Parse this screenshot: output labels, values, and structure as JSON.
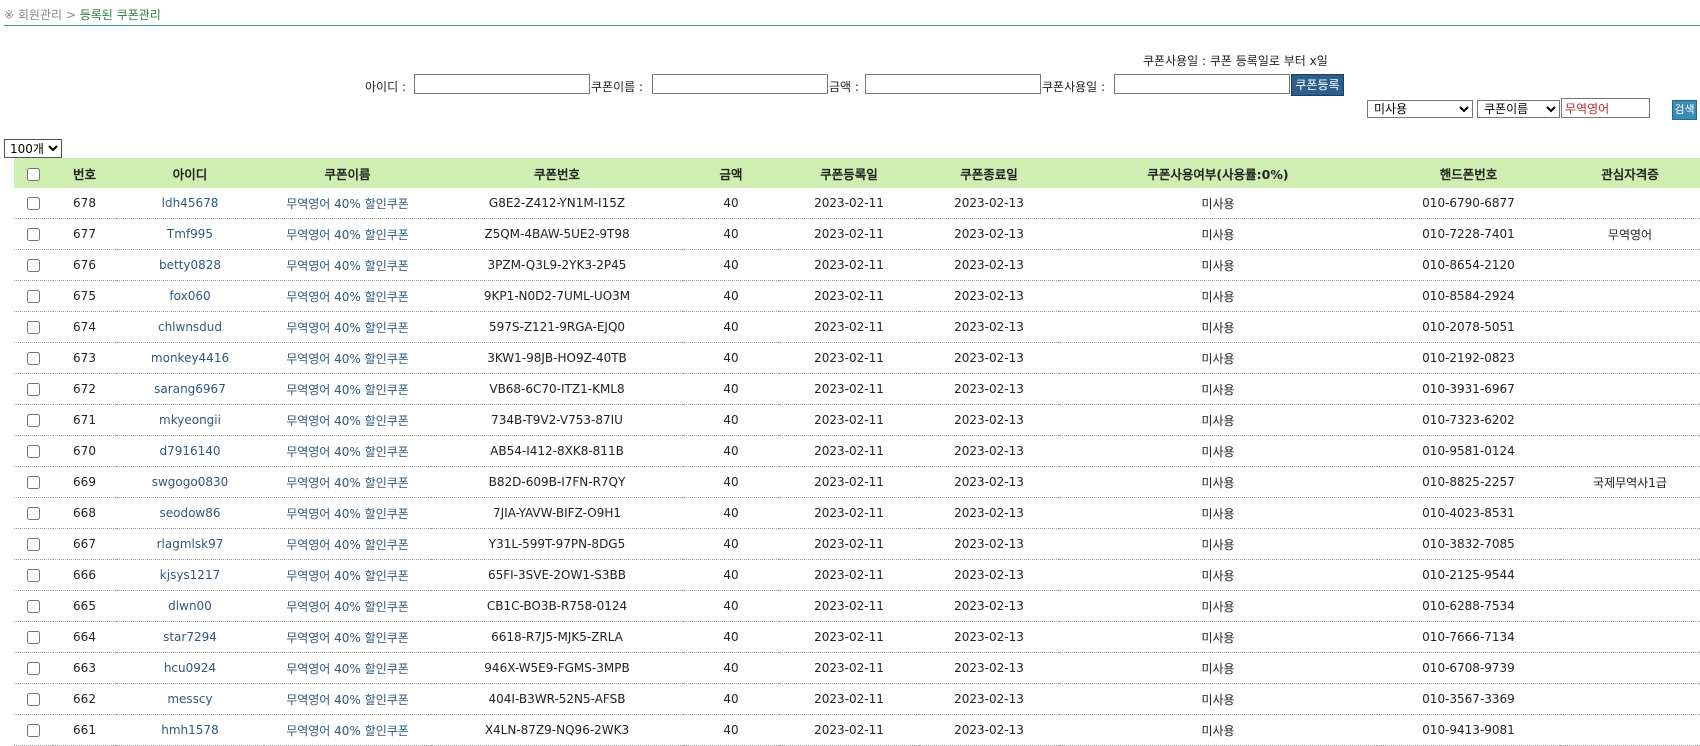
{
  "breadcrumb": {
    "prefix": "※ 회원관리 > ",
    "current": "등록된 쿠폰관리"
  },
  "note": "쿠폰사용일 : 쿠폰 등록일로 부터 x일",
  "register": {
    "id_label": "아이디 :",
    "name_label": "쿠폰이름 :",
    "amount_label": "금액 :",
    "days_label": "쿠폰사용일 :",
    "submit": "쿠폰등록"
  },
  "search": {
    "status_selected": "미사용",
    "field_selected": "쿠폰이름",
    "keyword": "무역영어",
    "button": "검색"
  },
  "perpage": "100개",
  "table": {
    "headers": [
      "번호",
      "아이디",
      "쿠폰이름",
      "쿠폰번호",
      "금액",
      "쿠폰등록일",
      "쿠폰종료일",
      "쿠폰사용여부(사용률:0%)",
      "핸드폰번호",
      "관심자격증"
    ],
    "rows": [
      {
        "no": "678",
        "id": "ldh45678",
        "name": "무역영어 40% 할인쿠폰",
        "code": "G8E2-Z412-YN1M-I15Z",
        "amount": "40",
        "reg": "2023-02-11",
        "end": "2023-02-13",
        "used": "미사용",
        "phone": "010-6790-6877",
        "interest": ""
      },
      {
        "no": "677",
        "id": "Tmf995",
        "name": "무역영어 40% 할인쿠폰",
        "code": "Z5QM-4BAW-5UE2-9T98",
        "amount": "40",
        "reg": "2023-02-11",
        "end": "2023-02-13",
        "used": "미사용",
        "phone": "010-7228-7401",
        "interest": "무역영어"
      },
      {
        "no": "676",
        "id": "betty0828",
        "name": "무역영어 40% 할인쿠폰",
        "code": "3PZM-Q3L9-2YK3-2P45",
        "amount": "40",
        "reg": "2023-02-11",
        "end": "2023-02-13",
        "used": "미사용",
        "phone": "010-8654-2120",
        "interest": ""
      },
      {
        "no": "675",
        "id": "fox060",
        "name": "무역영어 40% 할인쿠폰",
        "code": "9KP1-N0D2-7UML-UO3M",
        "amount": "40",
        "reg": "2023-02-11",
        "end": "2023-02-13",
        "used": "미사용",
        "phone": "010-8584-2924",
        "interest": ""
      },
      {
        "no": "674",
        "id": "chlwnsdud",
        "name": "무역영어 40% 할인쿠폰",
        "code": "597S-Z121-9RGA-EJQ0",
        "amount": "40",
        "reg": "2023-02-11",
        "end": "2023-02-13",
        "used": "미사용",
        "phone": "010-2078-5051",
        "interest": ""
      },
      {
        "no": "673",
        "id": "monkey4416",
        "name": "무역영어 40% 할인쿠폰",
        "code": "3KW1-98JB-HO9Z-40TB",
        "amount": "40",
        "reg": "2023-02-11",
        "end": "2023-02-13",
        "used": "미사용",
        "phone": "010-2192-0823",
        "interest": ""
      },
      {
        "no": "672",
        "id": "sarang6967",
        "name": "무역영어 40% 할인쿠폰",
        "code": "VB68-6C70-ITZ1-KML8",
        "amount": "40",
        "reg": "2023-02-11",
        "end": "2023-02-13",
        "used": "미사용",
        "phone": "010-3931-6967",
        "interest": ""
      },
      {
        "no": "671",
        "id": "mkyeongii",
        "name": "무역영어 40% 할인쿠폰",
        "code": "734B-T9V2-V753-87IU",
        "amount": "40",
        "reg": "2023-02-11",
        "end": "2023-02-13",
        "used": "미사용",
        "phone": "010-7323-6202",
        "interest": ""
      },
      {
        "no": "670",
        "id": "d7916140",
        "name": "무역영어 40% 할인쿠폰",
        "code": "AB54-I412-8XK8-811B",
        "amount": "40",
        "reg": "2023-02-11",
        "end": "2023-02-13",
        "used": "미사용",
        "phone": "010-9581-0124",
        "interest": ""
      },
      {
        "no": "669",
        "id": "swgogo0830",
        "name": "무역영어 40% 할인쿠폰",
        "code": "B82D-609B-I7FN-R7QY",
        "amount": "40",
        "reg": "2023-02-11",
        "end": "2023-02-13",
        "used": "미사용",
        "phone": "010-8825-2257",
        "interest": "국제무역사1급"
      },
      {
        "no": "668",
        "id": "seodow86",
        "name": "무역영어 40% 할인쿠폰",
        "code": "7JIA-YAVW-BIFZ-O9H1",
        "amount": "40",
        "reg": "2023-02-11",
        "end": "2023-02-13",
        "used": "미사용",
        "phone": "010-4023-8531",
        "interest": ""
      },
      {
        "no": "667",
        "id": "rlagmlsk97",
        "name": "무역영어 40% 할인쿠폰",
        "code": "Y31L-599T-97PN-8DG5",
        "amount": "40",
        "reg": "2023-02-11",
        "end": "2023-02-13",
        "used": "미사용",
        "phone": "010-3832-7085",
        "interest": ""
      },
      {
        "no": "666",
        "id": "kjsys1217",
        "name": "무역영어 40% 할인쿠폰",
        "code": "65FI-3SVE-2OW1-S3BB",
        "amount": "40",
        "reg": "2023-02-11",
        "end": "2023-02-13",
        "used": "미사용",
        "phone": "010-2125-9544",
        "interest": ""
      },
      {
        "no": "665",
        "id": "dlwn00",
        "name": "무역영어 40% 할인쿠폰",
        "code": "CB1C-BO3B-R758-0124",
        "amount": "40",
        "reg": "2023-02-11",
        "end": "2023-02-13",
        "used": "미사용",
        "phone": "010-6288-7534",
        "interest": ""
      },
      {
        "no": "664",
        "id": "star7294",
        "name": "무역영어 40% 할인쿠폰",
        "code": "6618-R7J5-MJK5-ZRLA",
        "amount": "40",
        "reg": "2023-02-11",
        "end": "2023-02-13",
        "used": "미사용",
        "phone": "010-7666-7134",
        "interest": ""
      },
      {
        "no": "663",
        "id": "hcu0924",
        "name": "무역영어 40% 할인쿠폰",
        "code": "946X-W5E9-FGMS-3MPB",
        "amount": "40",
        "reg": "2023-02-11",
        "end": "2023-02-13",
        "used": "미사용",
        "phone": "010-6708-9739",
        "interest": ""
      },
      {
        "no": "662",
        "id": "messcy",
        "name": "무역영어 40% 할인쿠폰",
        "code": "404I-B3WR-52N5-AFSB",
        "amount": "40",
        "reg": "2023-02-11",
        "end": "2023-02-13",
        "used": "미사용",
        "phone": "010-3567-3369",
        "interest": ""
      },
      {
        "no": "661",
        "id": "hmh1578",
        "name": "무역영어 40% 할인쿠폰",
        "code": "X4LN-87Z9-NQ96-2WK3",
        "amount": "40",
        "reg": "2023-02-11",
        "end": "2023-02-13",
        "used": "미사용",
        "phone": "010-9413-9081",
        "interest": ""
      }
    ]
  }
}
